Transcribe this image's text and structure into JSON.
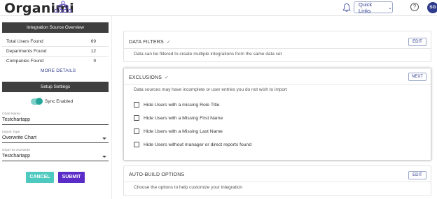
{
  "header": {
    "brand": "Organimi",
    "quick_links": "Quick Links",
    "help": "?",
    "avatar_initials": "SG"
  },
  "overview": {
    "title": "Integration Source Overview",
    "stats": [
      {
        "label": "Total Users Found",
        "value": "69"
      },
      {
        "label": "Departments Found",
        "value": "12"
      },
      {
        "label": "Companies Found",
        "value": "9"
      }
    ],
    "more_details": "MORE DETAILS"
  },
  "setup": {
    "title": "Setup Settings",
    "sync_label": "Sync Enabled",
    "sync_enabled": true,
    "chart_name_label": "Chart Name",
    "chart_name_value": "Testchartapp",
    "import_type_label": "Import Type",
    "import_type_value": "Overwrite Chart",
    "chart_to_overwrite_label": "Chart To Overwrite",
    "chart_to_overwrite_value": "Testchartapp",
    "cancel": "CANCEL",
    "submit": "SUBMIT"
  },
  "cards": {
    "data_filters": {
      "title": "DATA FILTERS",
      "button": "EDIT",
      "description": "Data can be filtered to create multiple integrations from the same data set"
    },
    "exclusions": {
      "title": "EXCLUSIONS",
      "button": "NEXT",
      "description": "Data sources may have incomplete or user entries you do not wish to import",
      "options": [
        "Hide Users with a missing Role Title",
        "Hide Users with a Missing First Name",
        "Hide Users with a Missing Last Name",
        "Hide Users without manager or direct reports found"
      ]
    },
    "auto_build": {
      "title": "AUTO-BUILD OPTIONS",
      "button": "EDIT",
      "description": "Choose the options to help customize your integration"
    }
  },
  "colors": {
    "brand_blue": "#2e3a8c",
    "teal": "#4ec9c0",
    "purple": "#5b2bc7",
    "dark_header": "#3f3f3f"
  }
}
